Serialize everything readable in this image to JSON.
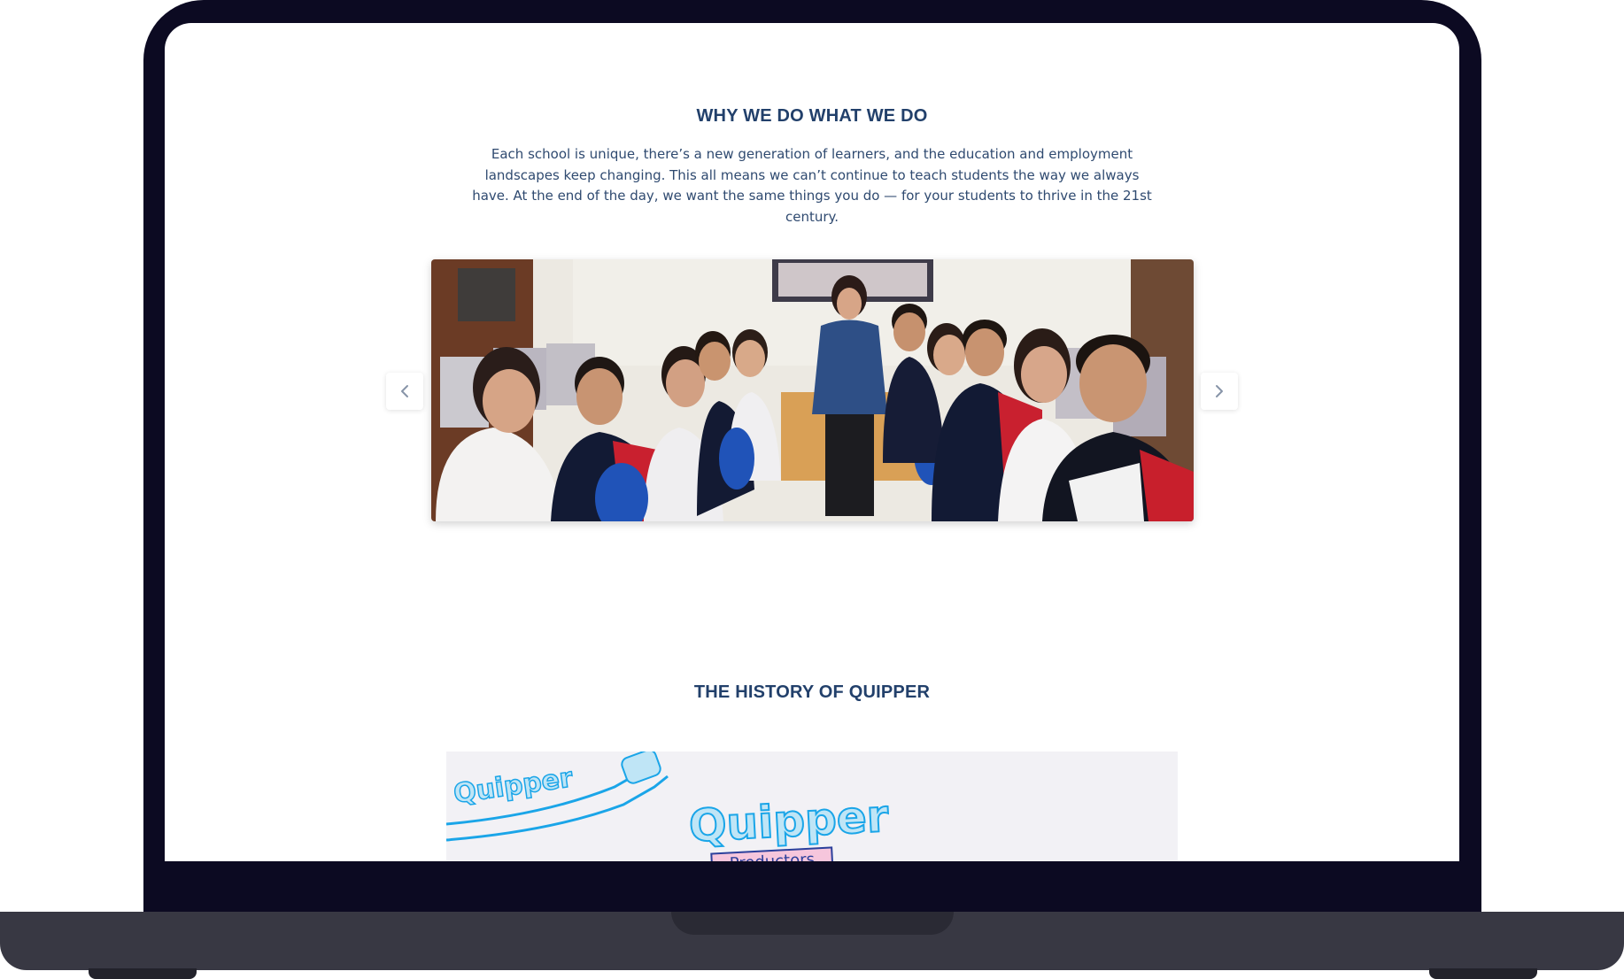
{
  "why_section": {
    "title": "WHY WE DO WHAT WE DO",
    "paragraph": "Each school is unique, there’s a new generation of learners, and the education and employment landscapes keep changing. This all means we can’t continue to teach students the way we always have. At the end of the day, we want the same things you do — for your students to thrive in the 21st century."
  },
  "carousel": {
    "prev_icon": "chevron-left-icon",
    "next_icon": "chevron-right-icon",
    "photo": "teacher-and-students-in-computer-lab-photo"
  },
  "history_section": {
    "title": "THE HISTORY OF QUIPPER",
    "media": {
      "banner_text": "Quipper",
      "logo_text": "Quipper",
      "sign_text": "Productors"
    }
  },
  "colors": {
    "heading": "#22406b",
    "body_text": "#2f4a70",
    "laptop_frame": "#0c0a22",
    "laptop_base": "#383843",
    "accent_blue": "#1aa5e8"
  }
}
